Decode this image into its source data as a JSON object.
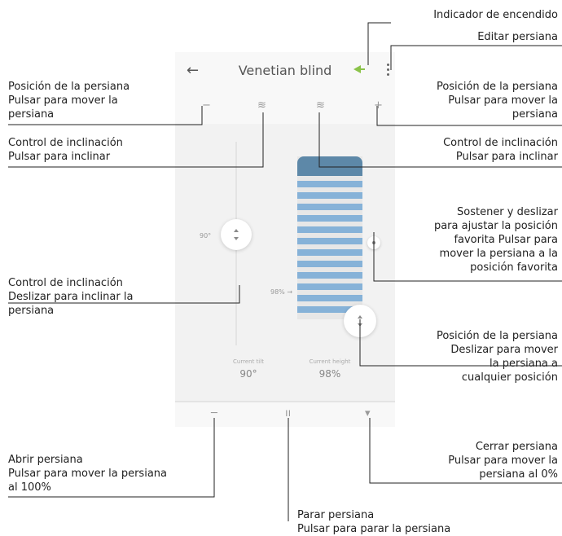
{
  "app": {
    "title": "Venetian blind",
    "tilt_readout_label": "Current tilt",
    "tilt_readout_value": "90°",
    "position_readout_label": "Current height",
    "position_readout_value": "98%",
    "tilt_slider_value": "90°",
    "position_slider_value": "98% →",
    "icons": {
      "back": "arrow-left-icon",
      "power": "power-indicator-icon",
      "more": "more-vertical-icon",
      "position_minus": "minus-icon",
      "tilt_left": "tilt-icon",
      "tilt_right": "tilt-icon",
      "position_plus": "plus-icon",
      "open": "arrow-up-icon",
      "stop": "pause-icon",
      "close": "arrow-down-icon"
    },
    "glyphs": {
      "back": "←",
      "minus": "−",
      "tilt": "≋",
      "plus": "+",
      "open": "─",
      "stop": "ıı",
      "close": "▾"
    },
    "colors": {
      "accent_green": "#8bc34a",
      "blind_head": "#5d88a8",
      "blind_slat": "#86b2d8"
    }
  },
  "annotations": {
    "power_indicator": "Indicador de encendido",
    "edit_blind": "Editar persiana",
    "position_left": "Posición de la persiana\nPulsar para mover la\npersiana",
    "position_right": "Posición de la persiana\nPulsar para mover la\npersiana",
    "tilt_left": "Control de inclinación\nPulsar para inclinar",
    "tilt_right": "Control de inclinación\nPulsar para inclinar",
    "favorite": "Sostener y deslizar\npara ajustar la posición\nfavorita Pulsar para\nmover la persiana a la\nposición favorita",
    "tilt_slider": "Control de inclinación\nDeslizar para inclinar la\npersiana",
    "position_slider": "Posición de la persiana\nDeslizar para mover\nla persiana a\ncualquier posición",
    "open_blind": "Abrir persiana\nPulsar para mover la persiana\nal 100%",
    "close_blind": "Cerrar persiana\nPulsar para mover la\npersiana al 0%",
    "stop_blind": "Parar persiana\nPulsar para parar la persiana"
  }
}
